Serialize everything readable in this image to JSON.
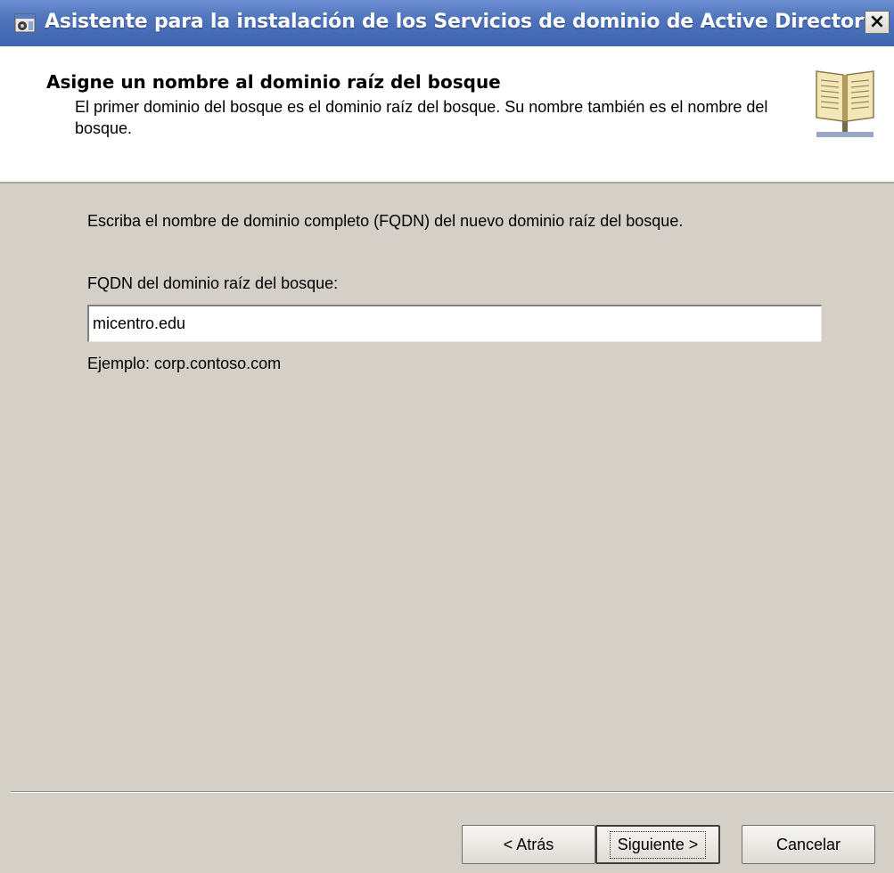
{
  "window": {
    "title": "Asistente para la instalación de los Servicios de dominio de Active Directory",
    "close_label": "×"
  },
  "header": {
    "title": "Asigne un nombre al dominio raíz del bosque",
    "description": "El primer dominio del bosque es el dominio raíz del bosque. Su nombre también es el nombre del bosque."
  },
  "body": {
    "instruction": "Escriba el nombre de dominio completo (FQDN) del nuevo dominio raíz del bosque.",
    "fqdn_label": "FQDN del dominio raíz del bosque:",
    "fqdn_value": "micentro.edu",
    "example": "Ejemplo: corp.contoso.com"
  },
  "buttons": {
    "back": "< Atrás",
    "next": "Siguiente >",
    "cancel": "Cancelar"
  },
  "icons": {
    "window": "wizard-app-icon",
    "close": "close-icon",
    "header": "book-directory-icon"
  },
  "colors": {
    "titlebar": "#4f74bd",
    "window_bg": "#d4d0c8",
    "header_bg": "#ffffff"
  }
}
